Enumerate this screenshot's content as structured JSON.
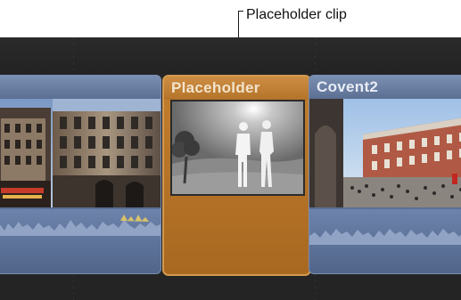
{
  "callout": {
    "label": "Placeholder clip"
  },
  "timeline": {
    "clips": [
      {
        "title": "",
        "kind": "video-with-audio"
      },
      {
        "title": "Placeholder",
        "kind": "placeholder"
      },
      {
        "title": "Covent2",
        "kind": "video-with-audio"
      }
    ]
  },
  "colors": {
    "timeline_bg": "#252526",
    "clip_blue": "#5a6f93",
    "clip_orange": "#b4742a",
    "callout_text": "#111111"
  }
}
